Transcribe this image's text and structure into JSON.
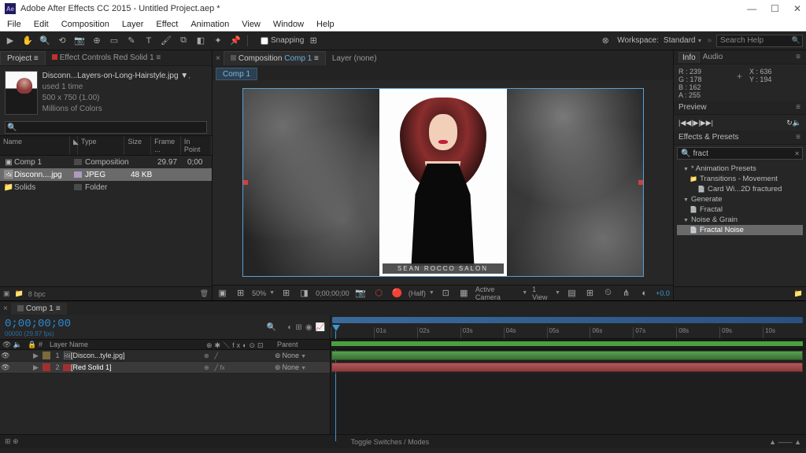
{
  "titlebar": {
    "icon": "Ae",
    "title": "Adobe After Effects CC 2015 - Untitled Project.aep *"
  },
  "menubar": [
    "File",
    "Edit",
    "Composition",
    "Layer",
    "Effect",
    "Animation",
    "View",
    "Window",
    "Help"
  ],
  "toolbar": {
    "snapping": "Snapping",
    "workspace_label": "Workspace:",
    "workspace_value": "Standard",
    "search_placeholder": "Search Help"
  },
  "project": {
    "tab_project": "Project",
    "tab_ec": "Effect Controls Red Solid 1",
    "file_name": "Disconn...Layers-on-Long-Hairstyle.jpg ▼",
    "file_used": ", used 1 time",
    "dims": "500 x 750 (1.00)",
    "colors": "Millions of Colors",
    "cols": {
      "name": "Name",
      "type": "Type",
      "size": "Size",
      "frame": "Frame ...",
      "inpoint": "In Point"
    },
    "rows": [
      {
        "name": "Comp 1",
        "type": "Composition",
        "size": "",
        "fr": "29.97",
        "in": "0;00"
      },
      {
        "name": "Disconn....jpg",
        "type": "JPEG",
        "size": "48 KB",
        "fr": "",
        "in": ""
      },
      {
        "name": "Solids",
        "type": "Folder",
        "size": "",
        "fr": "",
        "in": ""
      }
    ],
    "footer_bpc": "8 bpc"
  },
  "viewer": {
    "tab_comp_label": "Composition",
    "tab_comp_name": "Comp 1",
    "tab_layer": "Layer (none)",
    "crumb": "Comp 1",
    "caption": "SEAN ROCCO SALON",
    "footer": {
      "zoom": "50%",
      "time": "0;00;00;00",
      "res": "(Half)",
      "camera": "Active Camera",
      "view": "1 View",
      "exposure": "+0.0"
    }
  },
  "info": {
    "tab_info": "Info",
    "tab_audio": "Audio",
    "r": "R : 239",
    "g": "G : 178",
    "b": "B : 162",
    "a": "A : 255",
    "x": "X : 636",
    "y": "Y : 194"
  },
  "preview": {
    "label": "Preview"
  },
  "effects": {
    "label": "Effects & Presets",
    "search_ico": "🔍",
    "search": "fract",
    "tree": {
      "presets": "* Animation Presets",
      "trans": "Transitions - Movement",
      "card": "Card Wi...2D fractured",
      "generate": "Generate",
      "fractal": "Fractal",
      "noise": "Noise & Grain",
      "fractal_noise": "Fractal Noise"
    }
  },
  "timeline": {
    "tab": "Comp 1",
    "timecode": "0;00;00;00",
    "tc_sub": "00000 (29.97 fps)",
    "cols": {
      "layer": "Layer Name",
      "parent": "Parent"
    },
    "layers": [
      {
        "num": "1",
        "name": "[Discon...tyle.jpg]",
        "parent": "None",
        "color": "#7a6a3a"
      },
      {
        "num": "2",
        "name": "[Red Solid 1]",
        "parent": "None",
        "color": "#a03030"
      }
    ],
    "ticks": [
      "",
      "01s",
      "02s",
      "03s",
      "04s",
      "05s",
      "06s",
      "07s",
      "08s",
      "09s",
      "10s"
    ],
    "toggle": "Toggle Switches / Modes"
  }
}
